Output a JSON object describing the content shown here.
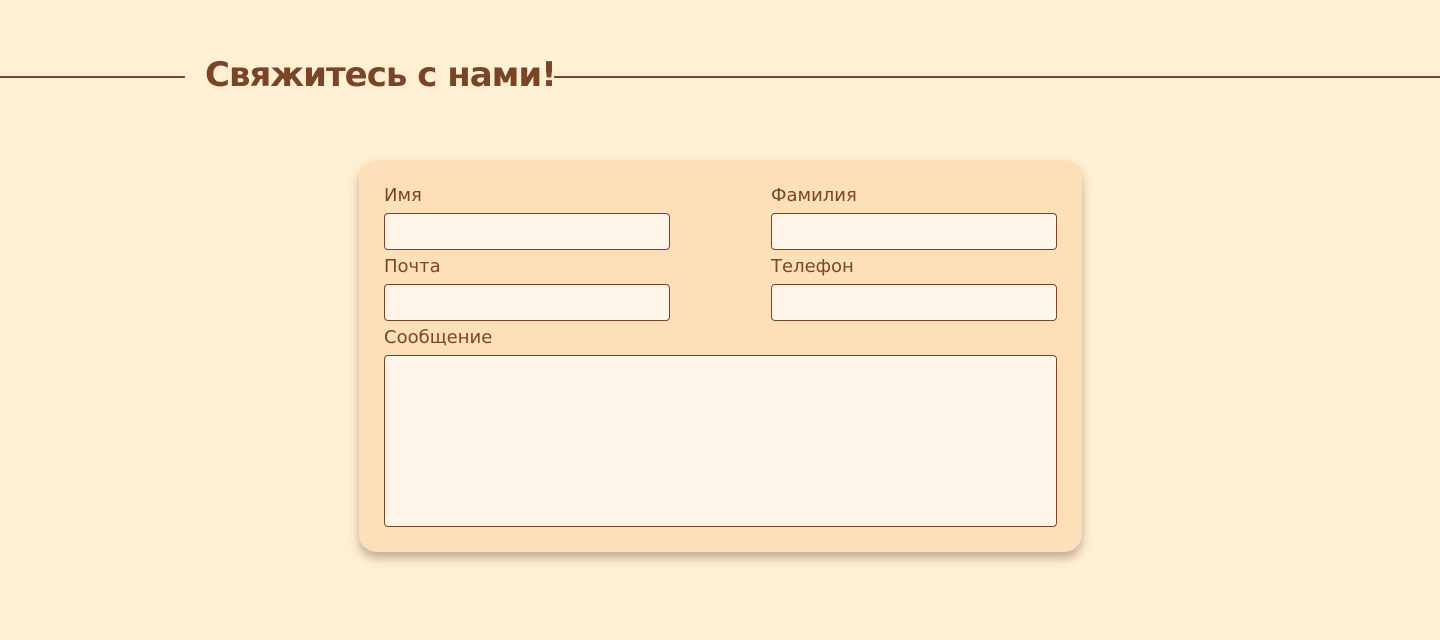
{
  "section": {
    "title": "Свяжитесь с нами!"
  },
  "form": {
    "first_name": {
      "label": "Имя",
      "value": "",
      "placeholder": ""
    },
    "last_name": {
      "label": "Фамилия",
      "value": "",
      "placeholder": ""
    },
    "email": {
      "label": "Почта",
      "value": "",
      "placeholder": ""
    },
    "phone": {
      "label": "Телефон",
      "value": "",
      "placeholder": ""
    },
    "message": {
      "label": "Сообщение",
      "value": "",
      "placeholder": ""
    }
  },
  "colors": {
    "page_background": "#FFF0D4",
    "card_background": "#FDE0BA",
    "field_background": "#FFF6E9",
    "accent_brown": "#7A4526"
  }
}
